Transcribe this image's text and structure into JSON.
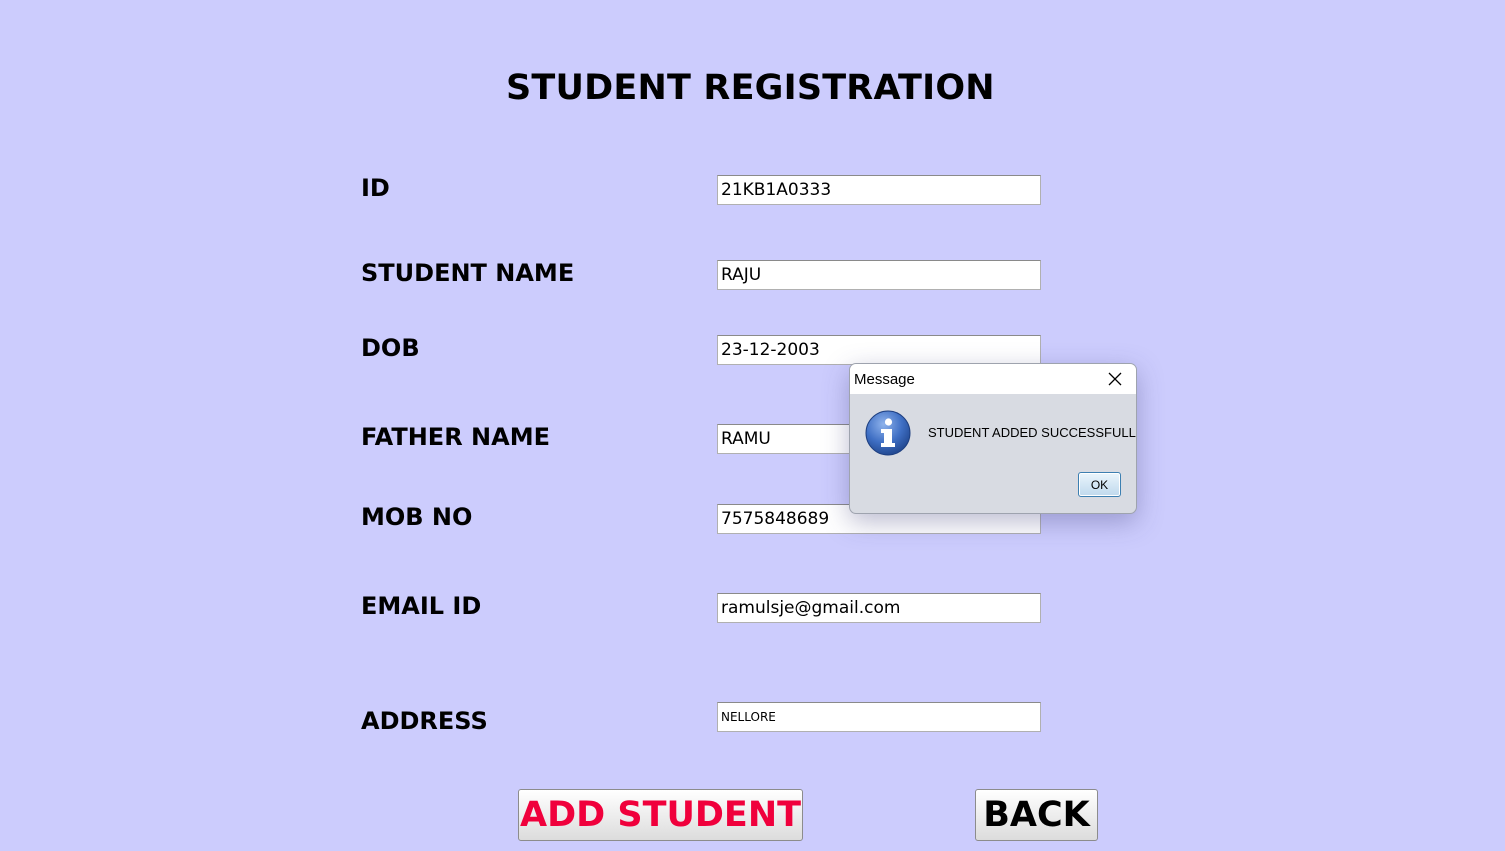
{
  "page": {
    "title": "STUDENT REGISTRATION"
  },
  "form": {
    "fields": [
      {
        "label": "ID",
        "value": "21KB1A0333"
      },
      {
        "label": "STUDENT NAME",
        "value": "RAJU"
      },
      {
        "label": "DOB",
        "value": "23-12-2003"
      },
      {
        "label": "FATHER NAME",
        "value": "RAMU"
      },
      {
        "label": "MOB NO",
        "value": "7575848689"
      },
      {
        "label": "EMAIL ID",
        "value": "ramulsje@gmail.com"
      },
      {
        "label": "ADDRESS",
        "value": "NELLORE"
      }
    ]
  },
  "buttons": {
    "add_label": "ADD STUDENT",
    "back_label": "BACK"
  },
  "dialog": {
    "title": "Message",
    "message": "STUDENT ADDED SUCCESSFULL",
    "ok_label": "OK",
    "icon": "info-icon",
    "close_icon": "close-icon"
  },
  "colors": {
    "background": "#ccccfd",
    "add_button_text": "#f0003c",
    "dialog_body": "#d8dbe2"
  }
}
